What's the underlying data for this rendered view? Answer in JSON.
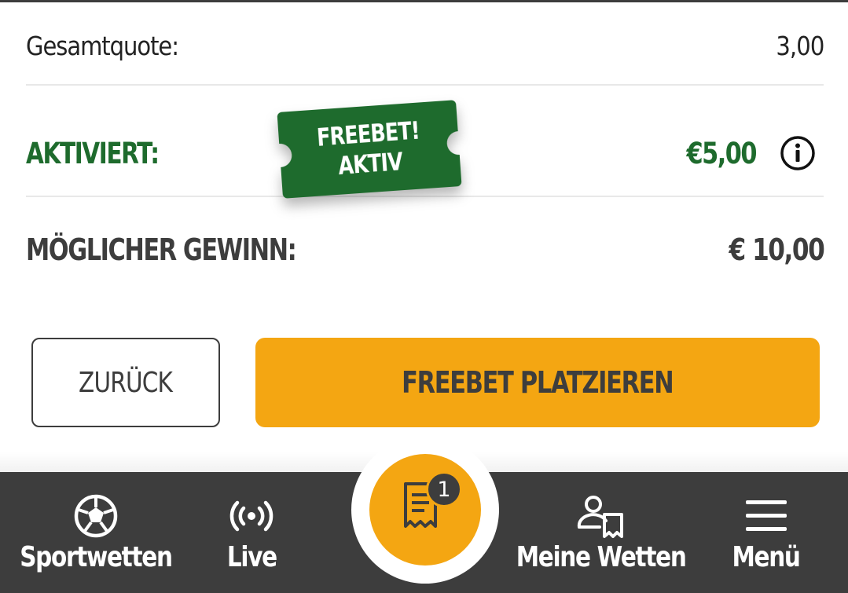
{
  "summary": {
    "total_odds_label": "Gesamtquote:",
    "total_odds_value": "3,00",
    "activated_label": "AKTIVIERT:",
    "activated_value": "€5,00",
    "possible_win_label": "MÖGLICHER GEWINN:",
    "possible_win_value": "€ 10,00"
  },
  "freebet_badge": {
    "line1": "FREEBET!",
    "line2": "AKTIV"
  },
  "actions": {
    "back_label": "ZURÜCK",
    "place_label": "FREEBET PLATZIEREN"
  },
  "nav": {
    "items": [
      {
        "label": "Sportwetten",
        "icon": "soccer-ball-icon"
      },
      {
        "label": "Live",
        "icon": "live-broadcast-icon"
      },
      {
        "label": "Meine Wetten",
        "icon": "my-bets-icon"
      },
      {
        "label": "Menü",
        "icon": "hamburger-menu-icon"
      }
    ],
    "bet_slip": {
      "icon": "bet-slip-icon",
      "count": "1"
    }
  },
  "colors": {
    "accent": "#f4a612",
    "green": "#1e6b2d",
    "dark": "#3d3d3d"
  }
}
